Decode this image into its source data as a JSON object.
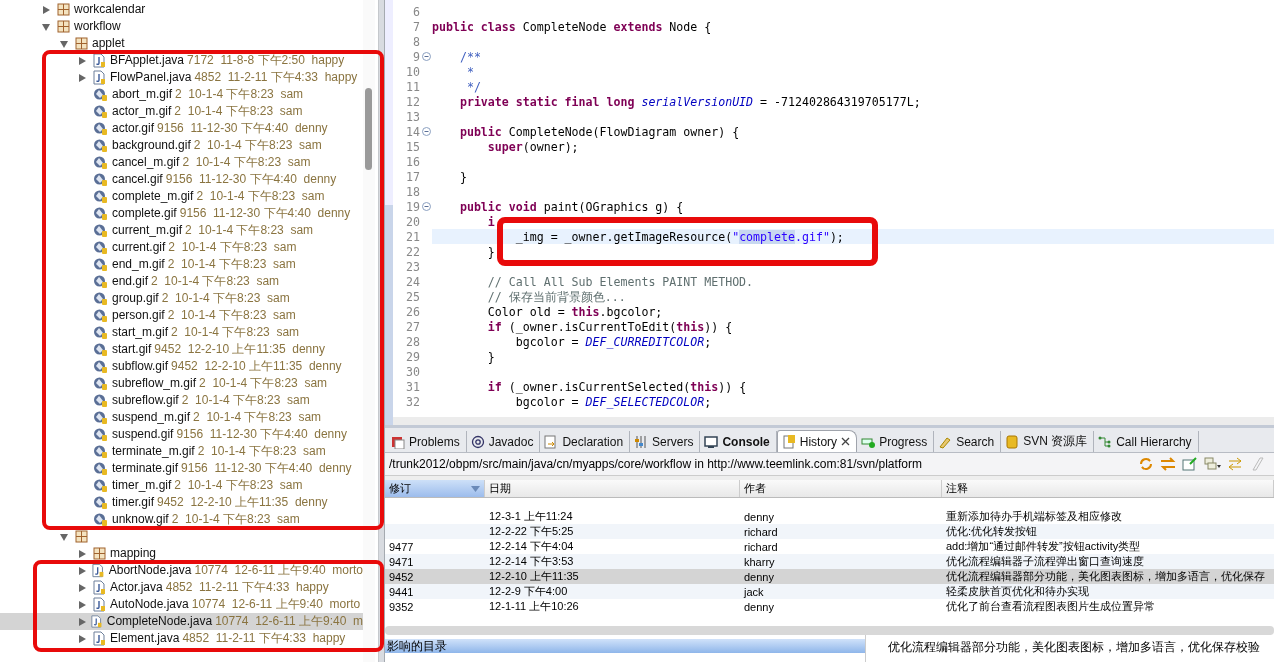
{
  "tree": [
    {
      "kind": "package",
      "name": "workcalendar",
      "expanded": false
    },
    {
      "kind": "package",
      "name": "workflow",
      "expanded": true,
      "children": [
        {
          "kind": "package",
          "name": "applet",
          "expanded": true,
          "children": [
            {
              "kind": "java",
              "name": "BFApplet.java",
              "revision": "7172",
              "date": "11-8-8 下午2:50",
              "author": "happy",
              "expanded": false,
              "selected": false
            },
            {
              "kind": "java",
              "name": "FlowPanel.java",
              "revision": "4852",
              "date": "11-2-11 下午4:33",
              "author": "happy",
              "expanded": false,
              "selected": false
            },
            {
              "kind": "gif",
              "name": "abort_m.gif",
              "revision": "2",
              "date": "10-1-4 下午8:23",
              "author": "sam",
              "selected": false
            },
            {
              "kind": "gif",
              "name": "actor_m.gif",
              "revision": "2",
              "date": "10-1-4 下午8:23",
              "author": "sam",
              "selected": false
            },
            {
              "kind": "gif",
              "name": "actor.gif",
              "revision": "9156",
              "date": "11-12-30 下午4:40",
              "author": "denny",
              "selected": false
            },
            {
              "kind": "gif",
              "name": "background.gif",
              "revision": "2",
              "date": "10-1-4 下午8:23",
              "author": "sam",
              "selected": false
            },
            {
              "kind": "gif",
              "name": "cancel_m.gif",
              "revision": "2",
              "date": "10-1-4 下午8:23",
              "author": "sam",
              "selected": false
            },
            {
              "kind": "gif",
              "name": "cancel.gif",
              "revision": "9156",
              "date": "11-12-30 下午4:40",
              "author": "denny",
              "selected": false
            },
            {
              "kind": "gif",
              "name": "complete_m.gif",
              "revision": "2",
              "date": "10-1-4 下午8:23",
              "author": "sam",
              "selected": false
            },
            {
              "kind": "gif",
              "name": "complete.gif",
              "revision": "9156",
              "date": "11-12-30 下午4:40",
              "author": "denny",
              "selected": false
            },
            {
              "kind": "gif",
              "name": "current_m.gif",
              "revision": "2",
              "date": "10-1-4 下午8:23",
              "author": "sam",
              "selected": false
            },
            {
              "kind": "gif",
              "name": "current.gif",
              "revision": "2",
              "date": "10-1-4 下午8:23",
              "author": "sam",
              "selected": false
            },
            {
              "kind": "gif",
              "name": "end_m.gif",
              "revision": "2",
              "date": "10-1-4 下午8:23",
              "author": "sam",
              "selected": false
            },
            {
              "kind": "gif",
              "name": "end.gif",
              "revision": "2",
              "date": "10-1-4 下午8:23",
              "author": "sam",
              "selected": false
            },
            {
              "kind": "gif",
              "name": "group.gif",
              "revision": "2",
              "date": "10-1-4 下午8:23",
              "author": "sam",
              "selected": false
            },
            {
              "kind": "gif",
              "name": "person.gif",
              "revision": "2",
              "date": "10-1-4 下午8:23",
              "author": "sam",
              "selected": false
            },
            {
              "kind": "gif",
              "name": "start_m.gif",
              "revision": "2",
              "date": "10-1-4 下午8:23",
              "author": "sam",
              "selected": false
            },
            {
              "kind": "gif",
              "name": "start.gif",
              "revision": "9452",
              "date": "12-2-10 上午11:35",
              "author": "denny",
              "selected": false
            },
            {
              "kind": "gif",
              "name": "subflow.gif",
              "revision": "9452",
              "date": "12-2-10 上午11:35",
              "author": "denny",
              "selected": false
            },
            {
              "kind": "gif",
              "name": "subreflow_m.gif",
              "revision": "2",
              "date": "10-1-4 下午8:23",
              "author": "sam",
              "selected": false
            },
            {
              "kind": "gif",
              "name": "subreflow.gif",
              "revision": "2",
              "date": "10-1-4 下午8:23",
              "author": "sam",
              "selected": false
            },
            {
              "kind": "gif",
              "name": "suspend_m.gif",
              "revision": "2",
              "date": "10-1-4 下午8:23",
              "author": "sam",
              "selected": false
            },
            {
              "kind": "gif",
              "name": "suspend.gif",
              "revision": "9156",
              "date": "11-12-30 下午4:40",
              "author": "denny",
              "selected": false
            },
            {
              "kind": "gif",
              "name": "terminate_m.gif",
              "revision": "2",
              "date": "10-1-4 下午8:23",
              "author": "sam",
              "selected": false
            },
            {
              "kind": "gif",
              "name": "terminate.gif",
              "revision": "9156",
              "date": "11-12-30 下午4:40",
              "author": "denny",
              "selected": false
            },
            {
              "kind": "gif",
              "name": "timer_m.gif",
              "revision": "2",
              "date": "10-1-4 下午8:23",
              "author": "sam",
              "selected": false
            },
            {
              "kind": "gif",
              "name": "timer.gif",
              "revision": "9452",
              "date": "12-2-10 上午11:35",
              "author": "denny",
              "selected": false
            },
            {
              "kind": "gif",
              "name": "unknow.gif",
              "revision": "2",
              "date": "10-1-4 下午8:23",
              "author": "sam",
              "selected": false
            }
          ]
        },
        {
          "kind": "package",
          "expanded": true,
          "children": [
            {
              "kind": "package",
              "name": "mapping",
              "expanded": false
            },
            {
              "kind": "java",
              "name": "AbortNode.java",
              "revision": "10774",
              "date": "12-6-11 上午9:40",
              "author": "morto",
              "expanded": false,
              "selected": false
            },
            {
              "kind": "java",
              "name": "Actor.java",
              "revision": "4852",
              "date": "11-2-11 下午4:33",
              "author": "happy",
              "expanded": false,
              "selected": false
            },
            {
              "kind": "java",
              "name": "AutoNode.java",
              "revision": "10774",
              "date": "12-6-11 上午9:40",
              "author": "morto",
              "expanded": false,
              "selected": false
            },
            {
              "kind": "java",
              "name": "CompleteNode.java",
              "revision": "10774",
              "date": "12-6-11 上午9:40",
              "author": "m",
              "expanded": false,
              "selected": true
            },
            {
              "kind": "java",
              "name": "Element.java",
              "revision": "4852",
              "date": "11-2-11 下午4:33",
              "author": "happy",
              "expanded": false,
              "selected": false
            }
          ]
        }
      ]
    }
  ],
  "editor": {
    "lines": [
      {
        "number": "6",
        "fold": false,
        "current": false
      },
      {
        "number": "7",
        "fold": false,
        "current": false,
        "tokens": [
          {
            "kind": "keyword",
            "text": "public class"
          },
          {
            "kind": "plain",
            "text": " CompleteNode "
          },
          {
            "kind": "keyword",
            "text": "extends"
          },
          {
            "kind": "plain",
            "text": " Node {"
          }
        ]
      },
      {
        "number": "8",
        "fold": false,
        "current": false
      },
      {
        "number": "9",
        "fold": true,
        "current": false,
        "tokens": [
          {
            "kind": "doc",
            "text": "    /**"
          }
        ]
      },
      {
        "number": "10",
        "fold": false,
        "current": false,
        "tokens": [
          {
            "kind": "doc",
            "text": "     *"
          }
        ]
      },
      {
        "number": "11",
        "fold": false,
        "current": false,
        "tokens": [
          {
            "kind": "doc",
            "text": "     */"
          }
        ]
      },
      {
        "number": "12",
        "fold": false,
        "current": false,
        "tokens": [
          {
            "kind": "keyword",
            "text": "    private static final long"
          },
          {
            "kind": "field",
            "text": " serialVersionUID"
          },
          {
            "kind": "plain",
            "text": " = -712402864319705177L;"
          }
        ]
      },
      {
        "number": "13",
        "fold": false,
        "current": false
      },
      {
        "number": "14",
        "fold": true,
        "current": false,
        "tokens": [
          {
            "kind": "keyword",
            "text": "    public"
          },
          {
            "kind": "plain",
            "text": " CompleteNode(FlowDiagram owner) {"
          }
        ]
      },
      {
        "number": "15",
        "fold": false,
        "current": false,
        "tokens": [
          {
            "kind": "keyword",
            "text": "        super"
          },
          {
            "kind": "plain",
            "text": "(owner);"
          }
        ]
      },
      {
        "number": "16",
        "fold": false,
        "current": false
      },
      {
        "number": "17",
        "fold": false,
        "current": false,
        "tokens": [
          {
            "kind": "plain",
            "text": "    }"
          }
        ]
      },
      {
        "number": "18",
        "fold": false,
        "current": false
      },
      {
        "number": "19",
        "fold": true,
        "current": false,
        "tokens": [
          {
            "kind": "keyword",
            "text": "    public void"
          },
          {
            "kind": "plain",
            "text": " paint(OGraphics g) {"
          }
        ]
      },
      {
        "number": "20",
        "fold": false,
        "current": false,
        "tokens": [
          {
            "kind": "keyword",
            "text": "        i"
          }
        ]
      },
      {
        "number": "21",
        "fold": false,
        "current": true,
        "tokens": [
          {
            "kind": "plain",
            "text": "            _img = _owner.getImageResource("
          },
          {
            "kind": "string",
            "text": "\""
          },
          {
            "kind": "selection",
            "text": "complete"
          },
          {
            "kind": "string",
            "text": ".gif\""
          },
          {
            "kind": "plain",
            "text": ");"
          }
        ]
      },
      {
        "number": "22",
        "fold": false,
        "current": false,
        "tokens": [
          {
            "kind": "plain",
            "text": "        }"
          }
        ]
      },
      {
        "number": "23",
        "fold": false,
        "current": false
      },
      {
        "number": "24",
        "fold": false,
        "current": false,
        "tokens": [
          {
            "kind": "comment",
            "text": "        // Call All Sub Elements PAINT METHOD."
          }
        ]
      },
      {
        "number": "25",
        "fold": false,
        "current": false,
        "tokens": [
          {
            "kind": "comment",
            "text": "        // 保存当前背景颜色..."
          }
        ]
      },
      {
        "number": "26",
        "fold": false,
        "current": false,
        "tokens": [
          {
            "kind": "plain",
            "text": "        Color old = "
          },
          {
            "kind": "keyword",
            "text": "this"
          },
          {
            "kind": "plain",
            "text": ".bgcolor;"
          }
        ]
      },
      {
        "number": "27",
        "fold": false,
        "current": false,
        "tokens": [
          {
            "kind": "keyword",
            "text": "        if"
          },
          {
            "kind": "plain",
            "text": " (_owner.isCurrentToEdit("
          },
          {
            "kind": "keyword",
            "text": "this"
          },
          {
            "kind": "plain",
            "text": ")) {"
          }
        ]
      },
      {
        "number": "28",
        "fold": false,
        "current": false,
        "tokens": [
          {
            "kind": "plain",
            "text": "            bgcolor = "
          },
          {
            "kind": "field",
            "text": "DEF_CURREDITCOLOR"
          },
          {
            "kind": "plain",
            "text": ";"
          }
        ]
      },
      {
        "number": "29",
        "fold": false,
        "current": false,
        "tokens": [
          {
            "kind": "plain",
            "text": "        }"
          }
        ]
      },
      {
        "number": "30",
        "fold": false,
        "current": false
      },
      {
        "number": "31",
        "fold": false,
        "current": false,
        "tokens": [
          {
            "kind": "keyword",
            "text": "        if"
          },
          {
            "kind": "plain",
            "text": " (_owner.isCurrentSelected("
          },
          {
            "kind": "keyword",
            "text": "this"
          },
          {
            "kind": "plain",
            "text": ")) {"
          }
        ]
      },
      {
        "number": "32",
        "fold": false,
        "current": false,
        "tokens": [
          {
            "kind": "plain",
            "text": "            bgcolor = "
          },
          {
            "kind": "field",
            "text": "DEF_SELECTEDCOLOR"
          },
          {
            "kind": "plain",
            "text": ";"
          }
        ]
      }
    ]
  },
  "panel": {
    "tabs": [
      {
        "label": "Problems",
        "selected": false,
        "emphasized": false
      },
      {
        "label": "Javadoc",
        "selected": false,
        "emphasized": false
      },
      {
        "label": "Declaration",
        "selected": false,
        "emphasized": false
      },
      {
        "label": "Servers",
        "selected": false,
        "emphasized": false
      },
      {
        "label": "Console",
        "selected": false,
        "emphasized": true
      },
      {
        "label": "History",
        "selected": true,
        "emphasized": false
      },
      {
        "label": "Progress",
        "selected": false,
        "emphasized": false
      },
      {
        "label": "Search",
        "selected": false,
        "emphasized": false
      },
      {
        "label": "SVN 资源库",
        "selected": false,
        "emphasized": false
      },
      {
        "label": "Call Hierarchy",
        "selected": false,
        "emphasized": false
      }
    ],
    "path": "/trunk2012/obpm/src/main/java/cn/myapps/core/workflow in http://www.teemlink.com:81/svn/platform",
    "table": {
      "columns": [
        "修订",
        "日期",
        "作者",
        "注释"
      ],
      "rows": [
        {
          "date": "12-3-1 上午11:24",
          "author": "denny",
          "comment": "重新添加待办手机端标签及相应修改",
          "selected": false
        },
        {
          "date": "12-2-22 下午5:25",
          "author": "richard",
          "comment": "优化:优化转发按钮",
          "selected": false
        },
        {
          "revision": "9477",
          "date": "12-2-14 下午4:04",
          "author": "richard",
          "comment": "add:增加“通过邮件转发”按钮activity类型",
          "selected": false
        },
        {
          "revision": "9471",
          "date": "12-2-14 下午3:53",
          "author": "kharry",
          "comment": "优化流程编辑器子流程弹出窗口查询速度",
          "selected": false
        },
        {
          "revision": "9452",
          "date": "12-2-10 上午11:35",
          "author": "denny",
          "comment": "优化流程编辑器部分功能，美化图表图标，增加多语言，优化保存",
          "selected": true
        },
        {
          "revision": "9441",
          "date": "12-2-9 下午4:00",
          "author": "jack",
          "comment": "轻柔皮肤首页优化和待办实现",
          "selected": false
        },
        {
          "revision": "9352",
          "date": "12-1-11 上午10:26",
          "author": "denny",
          "comment": "优化了前台查看流程图表图片生成位置异常",
          "selected": false
        }
      ]
    },
    "affected_header": "影响的目录",
    "comment_detail": "优化流程编辑器部分功能，美化图表图标，增加多语言，优化保存校验"
  },
  "annotations": [
    {
      "kind": "frame"
    },
    {
      "kind": "frame"
    },
    {
      "kind": "frame"
    }
  ]
}
